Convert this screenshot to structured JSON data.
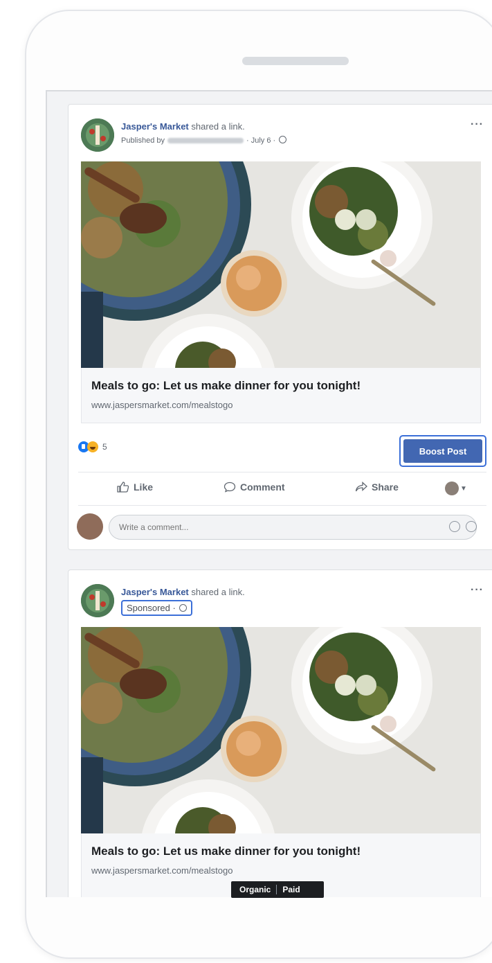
{
  "posts": [
    {
      "page_name": "Jasper's Market",
      "action_text": "shared a link.",
      "published_by_prefix": "Published by",
      "date": "July 6",
      "link_title": "Meals to go: Let us make dinner for you tonight!",
      "link_url": "www.jaspersmarket.com/mealstogo",
      "reaction_count": "5",
      "boost_label": "Boost Post",
      "actions": {
        "like": "Like",
        "comment": "Comment",
        "share": "Share"
      },
      "comment_placeholder": "Write a comment..."
    },
    {
      "page_name": "Jasper's Market",
      "action_text": "shared a link.",
      "sponsored_label": "Sponsored",
      "link_title": "Meals to go: Let us make dinner for you tonight!",
      "link_url": "www.jaspersmarket.com/mealstogo"
    }
  ],
  "toggle": {
    "organic": "Organic",
    "paid": "Paid"
  },
  "colors": {
    "facebook_blue": "#4267b2",
    "highlight_outline": "#3b6fd8",
    "page_link": "#385898"
  }
}
